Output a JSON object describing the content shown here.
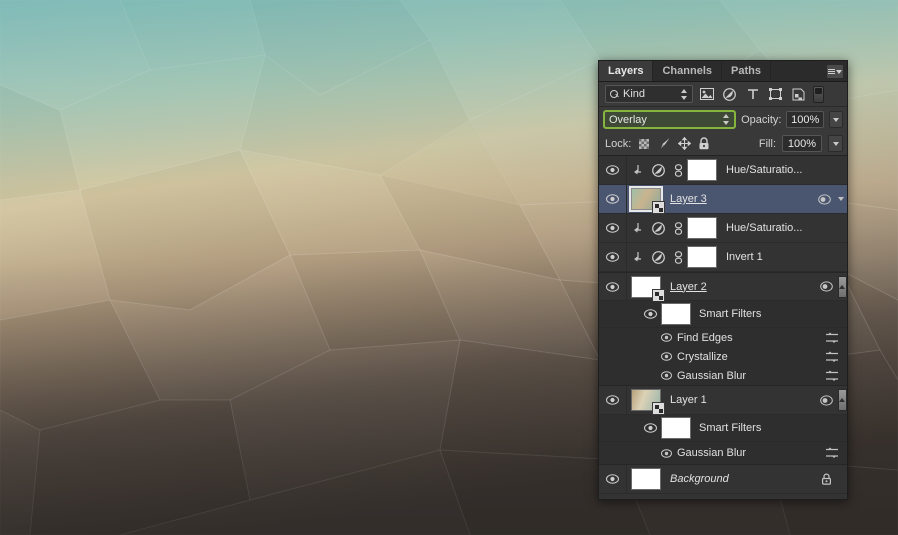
{
  "panel": {
    "tabs": [
      {
        "label": "Layers",
        "active": true
      },
      {
        "label": "Channels",
        "active": false
      },
      {
        "label": "Paths",
        "active": false
      }
    ],
    "menu_icon": "panel-menu-icon",
    "filter": {
      "search_icon": "search-icon",
      "kind_label": "Kind",
      "stepper_icon": "stepper-icon",
      "type_filters": [
        {
          "name": "filter-pixel-layers-icon",
          "title": "Pixel layers"
        },
        {
          "name": "filter-adjustment-layers-icon",
          "title": "Adjustment layers"
        },
        {
          "name": "filter-type-layers-icon",
          "title": "Type layers"
        },
        {
          "name": "filter-shape-layers-icon",
          "title": "Shape layers"
        },
        {
          "name": "filter-smart-objects-icon",
          "title": "Smart objects"
        }
      ],
      "toggle_icon": "filter-enable-toggle"
    },
    "blend": {
      "mode": "Overlay",
      "opacity_label": "Opacity:",
      "opacity_value": "100%",
      "fill_label": "Fill:",
      "fill_value": "100%",
      "highlight_color": "#86b53f"
    },
    "lock": {
      "label": "Lock:",
      "icons": [
        {
          "name": "lock-transparent-pixels-icon"
        },
        {
          "name": "lock-image-pixels-icon"
        },
        {
          "name": "lock-position-icon"
        },
        {
          "name": "lock-all-icon"
        }
      ]
    },
    "layers": [
      {
        "id": "hue-sat-2",
        "type": "adjustment",
        "name": "Hue/Saturatio...",
        "visible": true,
        "clipped": true,
        "linked": true,
        "thumb": "mask-white",
        "selected": false
      },
      {
        "id": "layer-3",
        "type": "smart-object",
        "name": "Layer 3",
        "visible": true,
        "selected": true,
        "editing": true,
        "thumb": "gradient",
        "has_smart_badge": true,
        "effects_icon": "smart-filter-indicator-icon",
        "dropdown_icon": "row-dropdown-icon"
      },
      {
        "id": "hue-sat-1",
        "type": "adjustment",
        "name": "Hue/Saturatio...",
        "visible": true,
        "clipped": true,
        "linked": true,
        "thumb": "mask-white",
        "selected": false
      },
      {
        "id": "invert-1",
        "type": "adjustment",
        "name": "Invert 1",
        "visible": true,
        "clipped": true,
        "linked": true,
        "thumb": "mask-white",
        "selected": false
      },
      {
        "id": "layer-2",
        "type": "smart-object",
        "name": "Layer 2",
        "visible": true,
        "selected": false,
        "editing": true,
        "thumb": "white",
        "has_smart_badge": true,
        "effects_icon": "smart-filter-indicator-icon",
        "collapse_icon": "collapse-up-icon",
        "smart_filters": {
          "label": "Smart Filters",
          "visible": true,
          "mask_thumb": "white",
          "items": [
            {
              "name": "Find Edges",
              "visible": true,
              "options_icon": "blending-options-icon"
            },
            {
              "name": "Crystallize",
              "visible": true,
              "options_icon": "blending-options-icon"
            },
            {
              "name": "Gaussian Blur",
              "visible": true,
              "options_icon": "blending-options-icon"
            }
          ]
        }
      },
      {
        "id": "layer-1",
        "type": "smart-object",
        "name": "Layer 1",
        "visible": true,
        "selected": false,
        "editing": false,
        "thumb": "gradient",
        "has_smart_badge": true,
        "effects_icon": "smart-filter-indicator-icon",
        "collapse_icon": "collapse-up-icon",
        "smart_filters": {
          "label": "Smart Filters",
          "visible": true,
          "mask_thumb": "white",
          "items": [
            {
              "name": "Gaussian Blur",
              "visible": true,
              "options_icon": "blending-options-icon"
            }
          ]
        }
      },
      {
        "id": "background",
        "type": "background",
        "name": "Background",
        "visible": true,
        "italic": true,
        "locked": true,
        "thumb": "white",
        "lock_icon": "lock-icon"
      }
    ]
  },
  "artwork": {
    "description": "low-poly crystallized gradient wallpaper",
    "colors": {
      "top": "#7ab6b4",
      "mid": "#d7c49a",
      "bottom": "#3a342f"
    }
  }
}
